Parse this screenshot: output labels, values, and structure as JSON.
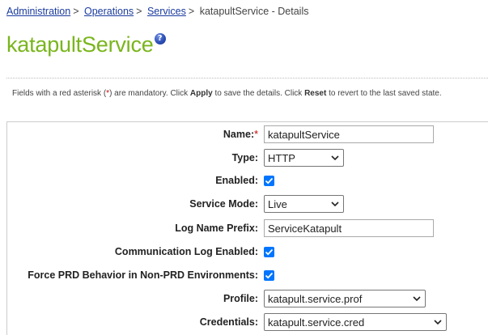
{
  "breadcrumb": {
    "items": [
      {
        "label": "Administration",
        "link": true
      },
      {
        "label": "Operations",
        "link": true
      },
      {
        "label": "Services",
        "link": true
      },
      {
        "label": "katapultService - Details",
        "link": false
      }
    ],
    "separator": ">"
  },
  "header": {
    "title": "katapultService",
    "help_glyph": "?"
  },
  "info": {
    "part1": "Fields with a red asterisk (",
    "asterisk": "*",
    "part2": ") are mandatory. Click ",
    "apply": "Apply",
    "part3": " to save the details. Click ",
    "reset": "Reset",
    "part4": " to revert to the last saved state."
  },
  "form": {
    "name": {
      "label": "Name:",
      "required_mark": "*",
      "value": "katapultService"
    },
    "type": {
      "label": "Type:",
      "value": "HTTP"
    },
    "enabled": {
      "label": "Enabled:",
      "checked": true
    },
    "service_mode": {
      "label": "Service Mode:",
      "value": "Live"
    },
    "log_prefix": {
      "label": "Log Name Prefix:",
      "value": "ServiceKatapult"
    },
    "comm_log": {
      "label": "Communication Log Enabled:",
      "checked": true
    },
    "force_prd": {
      "label": "Force PRD Behavior in Non-PRD Environments:",
      "checked": true
    },
    "profile": {
      "label": "Profile:",
      "value": "katapult.service.prof"
    },
    "credentials": {
      "label": "Credentials:",
      "value": "katapult.service.cred"
    }
  },
  "colors": {
    "title": "#7ab51d",
    "link": "#1a3b9e",
    "required": "#cc0000",
    "checkbox": "#0075ff"
  },
  "icons": {
    "help": "help-icon",
    "dropdown": "chevron-down-icon",
    "check": "check-icon"
  }
}
